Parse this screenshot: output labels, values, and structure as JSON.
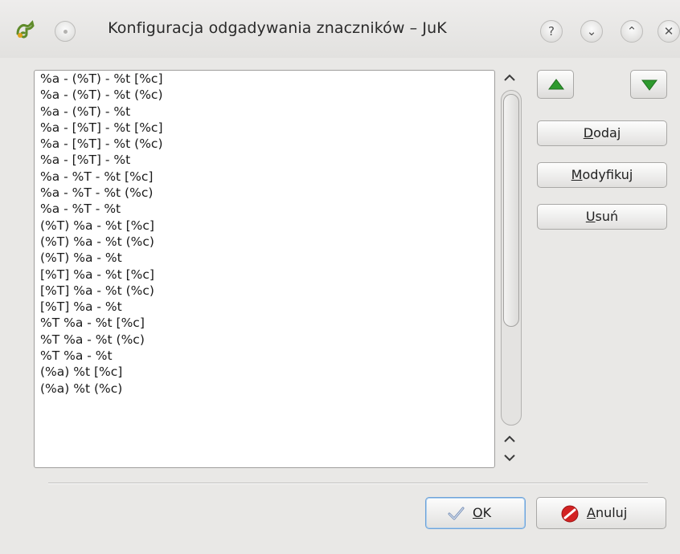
{
  "window": {
    "title": "Konfiguracja odgadywania znaczników – JuK",
    "help_glyph": "?",
    "minimize_glyph": "⌄",
    "maximize_glyph": "⌃",
    "close_glyph": "✕"
  },
  "list": {
    "items": [
      "%a - (%T) - %t [%c]",
      "%a - (%T) - %t (%c)",
      "%a - (%T) - %t",
      "%a - [%T] - %t [%c]",
      "%a - [%T] - %t (%c)",
      "%a - [%T] - %t",
      "%a - %T - %t [%c]",
      "%a - %T - %t (%c)",
      "%a - %T - %t",
      "(%T) %a - %t [%c]",
      "(%T) %a - %t (%c)",
      "(%T) %a - %t",
      "[%T] %a - %t [%c]",
      "[%T] %a - %t (%c)",
      "[%T] %a - %t",
      "%T %a - %t [%c]",
      "%T %a - %t (%c)",
      "%T %a - %t",
      "(%a) %t [%c]",
      "(%a) %t (%c)"
    ]
  },
  "buttons": {
    "add": {
      "mnemonic": "D",
      "rest": "odaj"
    },
    "modify": {
      "mnemonic": "M",
      "rest": "odyfikuj"
    },
    "remove": {
      "mnemonic": "U",
      "rest": "suń"
    },
    "ok": {
      "mnemonic": "O",
      "rest": "K"
    },
    "cancel": {
      "mnemonic": "A",
      "rest": "nuluj"
    }
  },
  "colors": {
    "accent_green": "#2e9a2e",
    "ok_focus_blue": "#6fa3d8",
    "cancel_red": "#d32222"
  }
}
